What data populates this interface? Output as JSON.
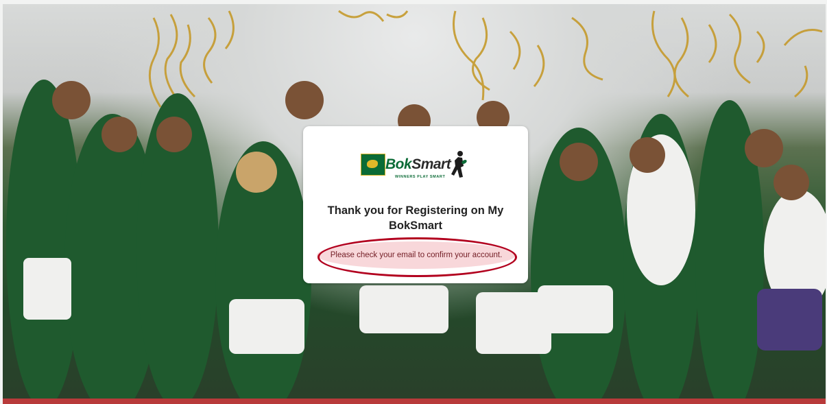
{
  "background": {
    "description_free": true
  },
  "card": {
    "logo_text_primary": "Bok",
    "logo_text_secondary": "Smart",
    "logo_tagline": "WINNERS PLAY SMART",
    "title": "Thank you for Registering on My BokSmart",
    "message": "Please check your email to confirm your account."
  },
  "colors": {
    "brand_green": "#0b6b36",
    "brand_gold": "#e1b929",
    "alert_bg": "#f8d7da",
    "alert_text": "#721c24",
    "highlight_ring": "#b2001e"
  }
}
